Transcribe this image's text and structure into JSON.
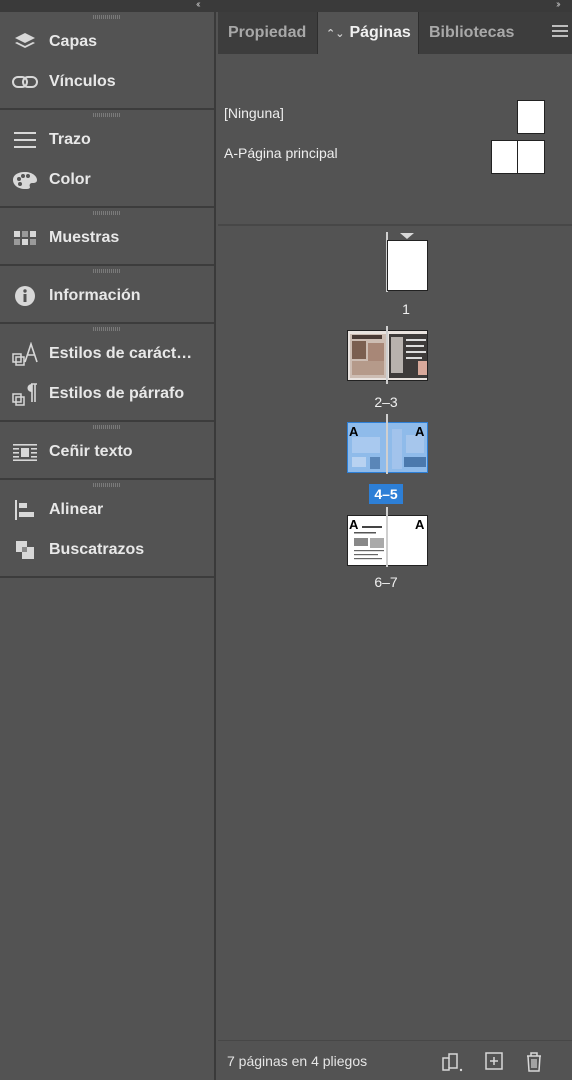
{
  "dock": {
    "groups": [
      {
        "items": [
          {
            "label": "Capas",
            "icon": "layers-icon"
          },
          {
            "label": "Vínculos",
            "icon": "links-icon"
          }
        ]
      },
      {
        "items": [
          {
            "label": "Trazo",
            "icon": "stroke-icon"
          },
          {
            "label": "Color",
            "icon": "palette-icon"
          }
        ]
      },
      {
        "items": [
          {
            "label": "Muestras",
            "icon": "swatches-icon"
          }
        ]
      },
      {
        "items": [
          {
            "label": "Información",
            "icon": "info-icon"
          }
        ]
      },
      {
        "items": [
          {
            "label": "Estilos de caráct…",
            "icon": "character-styles-icon"
          },
          {
            "label": "Estilos de párrafo",
            "icon": "paragraph-styles-icon"
          }
        ]
      },
      {
        "items": [
          {
            "label": "Ceñir texto",
            "icon": "text-wrap-icon"
          }
        ]
      },
      {
        "items": [
          {
            "label": "Alinear",
            "icon": "align-icon"
          },
          {
            "label": "Buscatrazos",
            "icon": "pathfinder-icon"
          }
        ]
      }
    ]
  },
  "panel": {
    "tabs": [
      {
        "label": "Propiedad"
      },
      {
        "label": "Páginas",
        "active": true
      },
      {
        "label": "Bibliotecas"
      }
    ],
    "masters": [
      {
        "label": "[Ninguna]"
      },
      {
        "label": "A-Página principal"
      }
    ],
    "spreads": [
      {
        "label": "1"
      },
      {
        "label": "2–3"
      },
      {
        "label": "4–5",
        "selected": true
      },
      {
        "label": "6–7"
      }
    ],
    "master_prefix": "A",
    "footer": {
      "count": "7 páginas en 4 pliegos"
    }
  },
  "colors": {
    "selection": "#2d7fd6",
    "panel_bg": "#535353",
    "tab_bar": "#3d3d3d"
  }
}
